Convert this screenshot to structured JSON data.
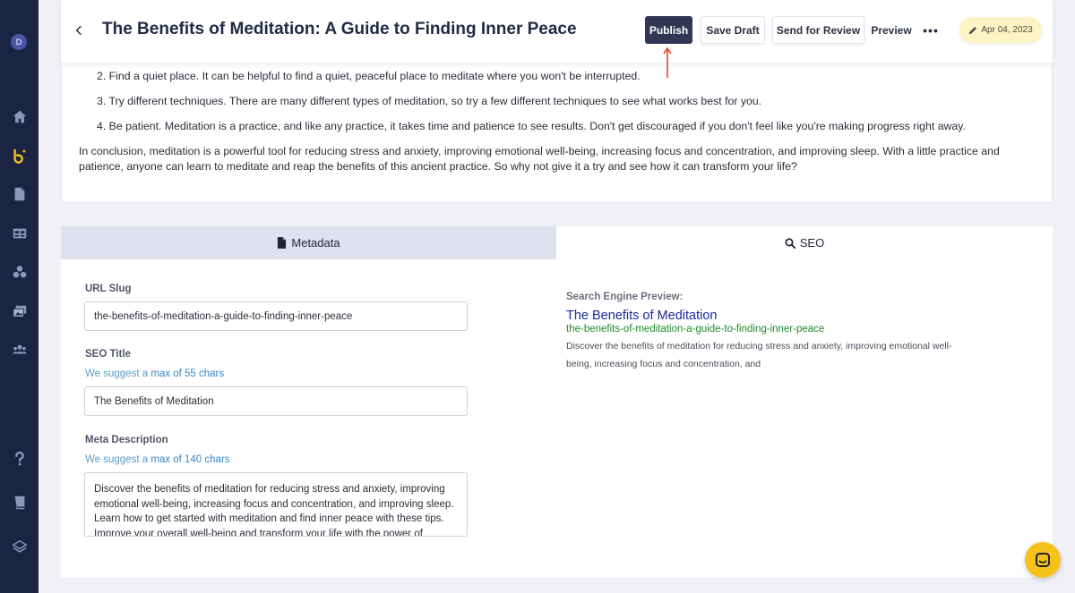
{
  "sidebar": {
    "avatar_initial": "D",
    "icons": [
      "home-icon",
      "brand-icon",
      "document-icon",
      "table-icon",
      "components-icon",
      "media-icon",
      "users-icon",
      "help-icon",
      "book-icon",
      "layers-icon"
    ]
  },
  "header": {
    "title": "The Benefits of Meditation: A Guide to Finding Inner Peace",
    "publish_label": "Publish",
    "save_draft_label": "Save Draft",
    "send_review_label": "Send for Review",
    "preview_label": "Preview",
    "more_label": "•••",
    "date": "Apr 04, 2023"
  },
  "content": {
    "list_items": [
      "2. Find a quiet place. It can be helpful to find a quiet, peaceful place to meditate where you won't be interrupted.",
      "3. Try different techniques. There are many different types of meditation, so try a few different techniques to see what works best for you.",
      "4. Be patient. Meditation is a practice, and like any practice, it takes time and patience to see results. Don't get discouraged if you don't feel like you're making progress right away."
    ],
    "conclusion": "In conclusion, meditation is a powerful tool for reducing stress and anxiety, improving emotional well-being, increasing focus and concentration, and improving sleep. With a little practice and patience, anyone can learn to meditate and reap the benefits of this ancient practice. So why not give it a try and see how it can transform your life?"
  },
  "tabs": {
    "metadata_label": "Metadata",
    "seo_label": "SEO"
  },
  "form": {
    "url_slug_label": "URL Slug",
    "url_slug_value": "the-benefits-of-meditation-a-guide-to-finding-inner-peace",
    "seo_title_label": "SEO Title",
    "seo_title_hint_prefix": "We suggest a ",
    "seo_title_hint_link": "max of 55 chars",
    "seo_title_value": "The Benefits of Meditation",
    "meta_desc_label": "Meta Description",
    "meta_desc_hint_prefix": "We suggest a ",
    "meta_desc_hint_link": "max of 140 chars",
    "meta_desc_value": "Discover the benefits of meditation for reducing stress and anxiety, improving emotional well-being, increasing focus and concentration, and improving sleep. Learn how to get started with meditation and find inner peace with these tips. Improve your overall well-being and transform your life with the power of meditation."
  },
  "seo_preview": {
    "heading": "Search Engine Preview:",
    "title": "The Benefits of Meditation",
    "url": "the-benefits-of-meditation-a-guide-to-finding-inner-peace",
    "description": "Discover the benefits of meditation for reducing stress and anxiety, improving emotional well-being, increasing focus and concentration, and"
  },
  "colors": {
    "sidebar": "#1b2442",
    "publish": "#2f3754",
    "date_pill": "#fdf3c4",
    "seo_title": "#1a2a9a",
    "seo_url": "#21892e",
    "chat": "#f6c21a",
    "annotation_arrow": "#e8452c"
  }
}
